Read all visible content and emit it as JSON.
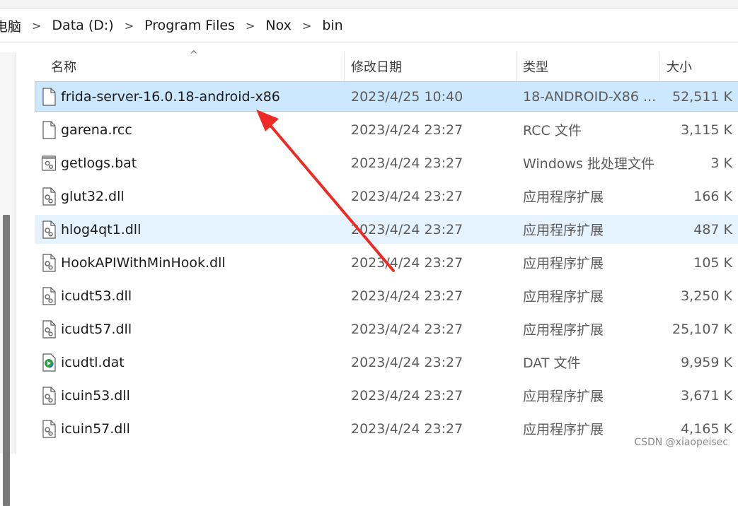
{
  "breadcrumb": [
    "电脑",
    "Data (D:)",
    "Program Files",
    "Nox",
    "bin"
  ],
  "columns": {
    "name": "名称",
    "modified": "修改日期",
    "type": "类型",
    "size": "大小"
  },
  "sort_indicator": "^",
  "files": [
    {
      "name": "frida-server-16.0.18-android-x86",
      "date": "2023/4/25 10:40",
      "type": "18-ANDROID-X86 ...",
      "size": "52,511 K",
      "icon": "blank-file-icon",
      "state": "selected"
    },
    {
      "name": "garena.rcc",
      "date": "2023/4/24 23:27",
      "type": "RCC 文件",
      "size": "3,115 K",
      "icon": "blank-file-icon",
      "state": ""
    },
    {
      "name": "getlogs.bat",
      "date": "2023/4/24 23:27",
      "type": "Windows 批处理文件",
      "size": "3 K",
      "icon": "batch-file-icon",
      "state": ""
    },
    {
      "name": "glut32.dll",
      "date": "2023/4/24 23:27",
      "type": "应用程序扩展",
      "size": "166 K",
      "icon": "dll-file-icon",
      "state": ""
    },
    {
      "name": "hlog4qt1.dll",
      "date": "2023/4/24 23:27",
      "type": "应用程序扩展",
      "size": "487 K",
      "icon": "dll-file-icon",
      "state": "hover"
    },
    {
      "name": "HookAPIWithMinHook.dll",
      "date": "2023/4/24 23:27",
      "type": "应用程序扩展",
      "size": "105 K",
      "icon": "dll-file-icon",
      "state": ""
    },
    {
      "name": "icudt53.dll",
      "date": "2023/4/24 23:27",
      "type": "应用程序扩展",
      "size": "3,250 K",
      "icon": "dll-file-icon",
      "state": ""
    },
    {
      "name": "icudt57.dll",
      "date": "2023/4/24 23:27",
      "type": "应用程序扩展",
      "size": "25,107 K",
      "icon": "dll-file-icon",
      "state": ""
    },
    {
      "name": "icudtl.dat",
      "date": "2023/4/24 23:27",
      "type": "DAT 文件",
      "size": "9,959 K",
      "icon": "media-file-icon",
      "state": ""
    },
    {
      "name": "icuin53.dll",
      "date": "2023/4/24 23:27",
      "type": "应用程序扩展",
      "size": "3,671 K",
      "icon": "dll-file-icon",
      "state": ""
    },
    {
      "name": "icuin57.dll",
      "date": "2023/4/24 23:27",
      "type": "应用程序扩展",
      "size": "4,165 K",
      "icon": "dll-file-icon",
      "state": ""
    }
  ],
  "annotation": {
    "color": "#ee2a24"
  },
  "watermark": "CSDN @xiaopeisec"
}
